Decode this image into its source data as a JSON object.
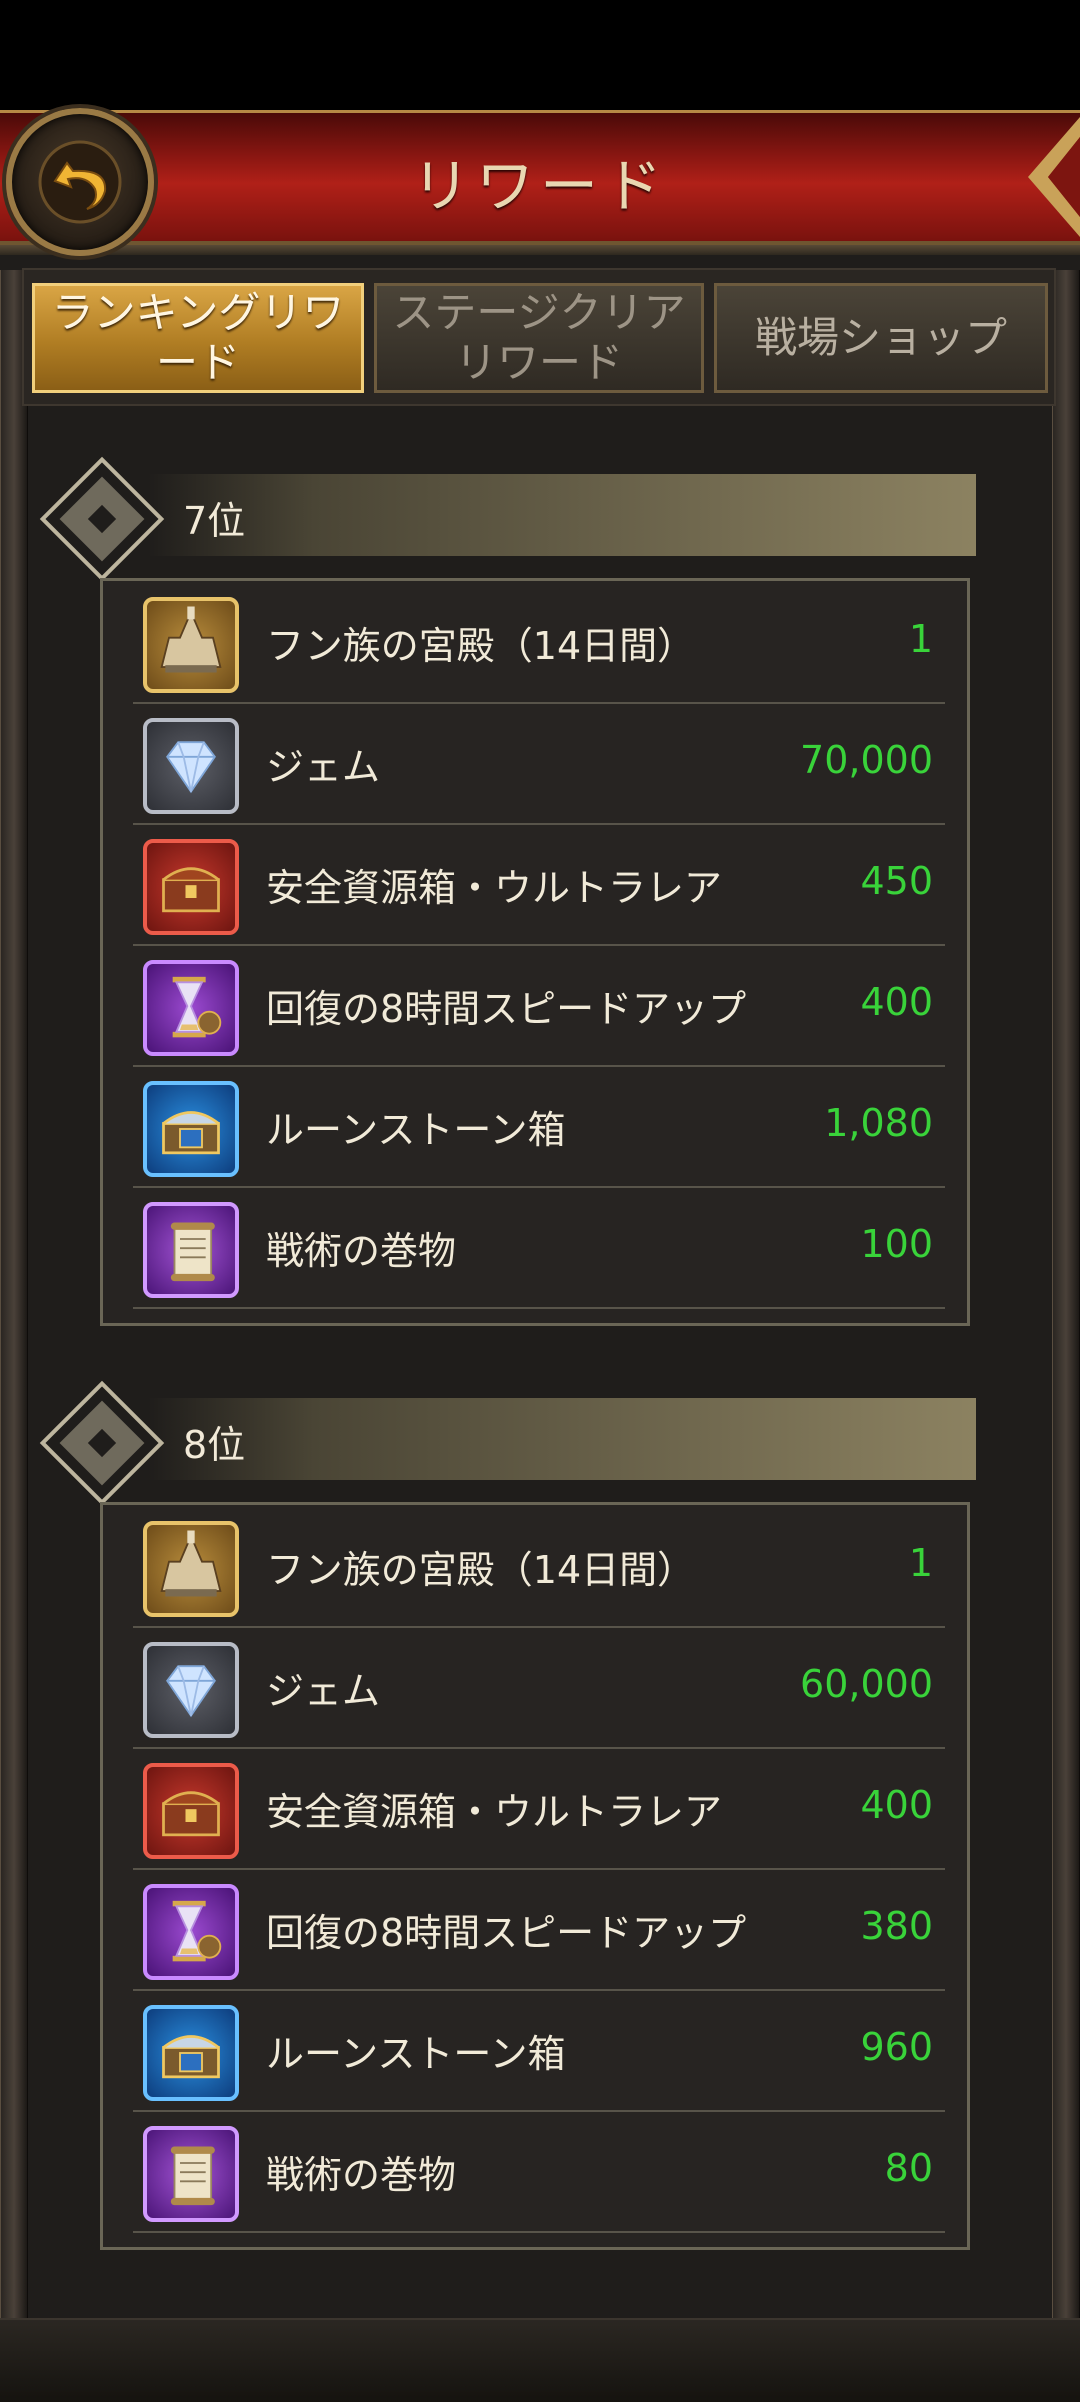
{
  "header": {
    "title": "リワード"
  },
  "tabs": [
    {
      "label_line1": "ランキングリワ",
      "label_line2": "ード"
    },
    {
      "label_line1": "ステージクリア",
      "label_line2": "リワード"
    },
    {
      "label": "戦場ショップ"
    }
  ],
  "ranks": [
    {
      "label": "7位",
      "items": [
        {
          "icon": "palace-icon",
          "name": "フン族の宮殿（14日間）",
          "qty": "1"
        },
        {
          "icon": "gem-icon",
          "name": "ジェム",
          "qty": "70,000"
        },
        {
          "icon": "resource-chest-icon",
          "name": "安全資源箱・ウルトラレア",
          "qty": "450"
        },
        {
          "icon": "hourglass-icon",
          "name": "回復の8時間スピードアップ",
          "qty": "400"
        },
        {
          "icon": "runestone-chest-icon",
          "name": "ルーンストーン箱",
          "qty": "1,080"
        },
        {
          "icon": "scroll-icon",
          "name": "戦術の巻物",
          "qty": "100"
        }
      ]
    },
    {
      "label": "8位",
      "items": [
        {
          "icon": "palace-icon",
          "name": "フン族の宮殿（14日間）",
          "qty": "1"
        },
        {
          "icon": "gem-icon",
          "name": "ジェム",
          "qty": "60,000"
        },
        {
          "icon": "resource-chest-icon",
          "name": "安全資源箱・ウルトラレア",
          "qty": "400"
        },
        {
          "icon": "hourglass-icon",
          "name": "回復の8時間スピードアップ",
          "qty": "380"
        },
        {
          "icon": "runestone-chest-icon",
          "name": "ルーンストーン箱",
          "qty": "960"
        },
        {
          "icon": "scroll-icon",
          "name": "戦術の巻物",
          "qty": "80"
        }
      ]
    }
  ],
  "colors": {
    "header_red": "#b02018",
    "active_tab_gold": "#d9a545",
    "quantity_green": "#39d33a",
    "panel_bg": "#1f1d1b"
  }
}
